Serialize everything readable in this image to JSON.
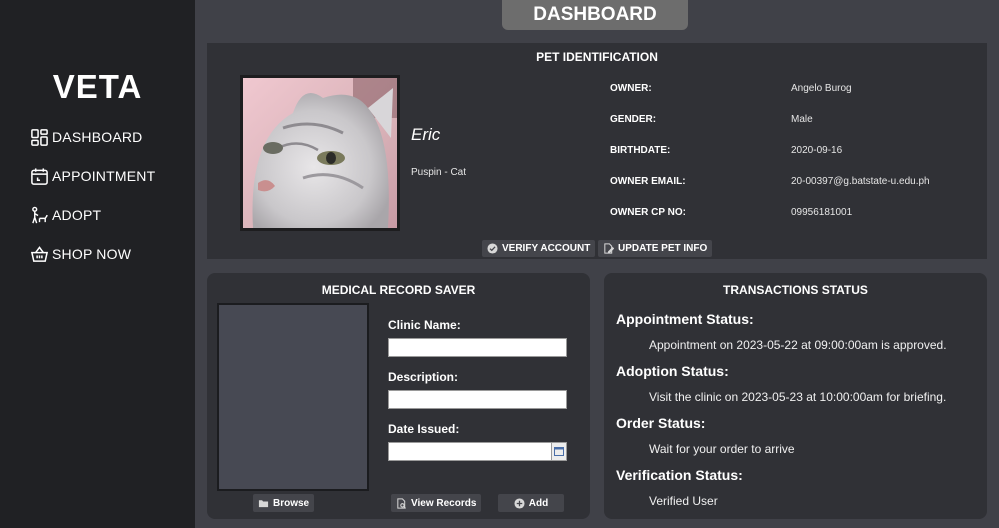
{
  "sidebar": {
    "brand": "VETA",
    "items": [
      {
        "label": "DASHBOARD",
        "icon": "dashboard-grid-icon"
      },
      {
        "label": "APPOINTMENT",
        "icon": "calendar-icon"
      },
      {
        "label": "ADOPT",
        "icon": "adopt-pet-icon"
      },
      {
        "label": "SHOP NOW",
        "icon": "shopping-basket-icon"
      }
    ]
  },
  "header": {
    "title": "DASHBOARD"
  },
  "pet": {
    "panel_title": "PET IDENTIFICATION",
    "name": "Eric",
    "breed": "Puspin - Cat",
    "photo_icon": "cat-photo",
    "info": [
      {
        "label": "OWNER:",
        "value": "Angelo Burog"
      },
      {
        "label": "GENDER:",
        "value": "Male"
      },
      {
        "label": "BIRTHDATE:",
        "value": "2020-09-16"
      },
      {
        "label": "OWNER EMAIL:",
        "value": "20-00397@g.batstate-u.edu.ph"
      },
      {
        "label": "OWNER CP NO:",
        "value": "09956181001"
      }
    ],
    "verify_label": "VERIFY ACCOUNT",
    "update_label": "UPDATE PET INFO"
  },
  "medical": {
    "panel_title": "MEDICAL RECORD SAVER",
    "clinic_label": "Clinic Name:",
    "clinic_value": "",
    "description_label": "Description:",
    "description_value": "",
    "date_label": "Date Issued:",
    "date_value": "",
    "browse_label": "Browse",
    "view_label": "View Records",
    "add_label": "Add"
  },
  "transactions": {
    "panel_title": "TRANSACTIONS STATUS",
    "items": [
      {
        "title": "Appointment Status:",
        "text": "Appointment on 2023-05-22 at 09:00:00am is approved."
      },
      {
        "title": "Adoption Status:",
        "text": "Visit the clinic on 2023-05-23 at 10:00:00am for briefing."
      },
      {
        "title": "Order Status:",
        "text": "Wait for your order to arrive"
      },
      {
        "title": "Verification Status:",
        "text": "Verified User"
      }
    ]
  },
  "colors": {
    "background": "#404148",
    "sidebar": "#202124",
    "panel": "#303136",
    "title_box": "#6d6d6d"
  }
}
